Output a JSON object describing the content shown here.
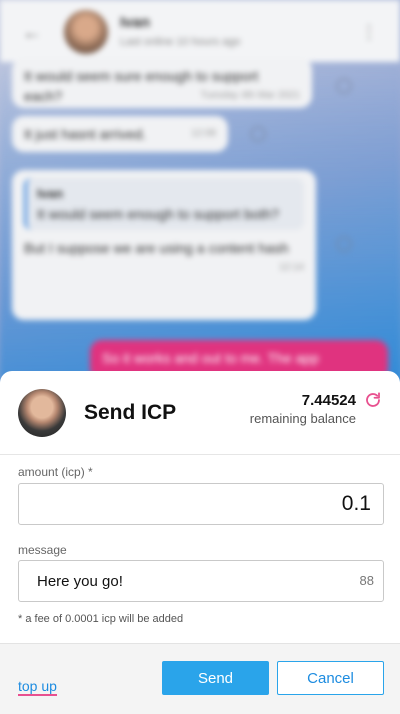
{
  "chat": {
    "header_name": "Ivan",
    "header_status": "Last online 10 hours ago",
    "messages": [
      {
        "text": "It would seem sure enough to support each?",
        "time": "Tuesday 4th Mar 2021"
      },
      {
        "text": "It just hasnt arrived.",
        "time": "12:08"
      },
      {
        "quote_name": "Ivan",
        "quote_text": "It would seem enough to support both?",
        "text": "But I suppose we are using a content hash",
        "time": "12:14"
      },
      {
        "text": "So it works and out to me. The app",
        "time": ""
      }
    ]
  },
  "dialog": {
    "title": "Send ICP",
    "balance_value": "7.44524",
    "balance_label": "remaining balance",
    "amount_label": "amount (icp) *",
    "amount_value": "0.1",
    "message_label": "message",
    "message_value": "Here you go!",
    "message_char_count": "88",
    "fee_note": "* a fee of 0.0001 icp will be added",
    "topup_label": "top up",
    "send_label": "Send",
    "cancel_label": "Cancel"
  },
  "colors": {
    "send_button": "#2aa4ea",
    "link": "#1d8ce0",
    "refresh_icon": "#e8508f",
    "link_underline": "#e8508f"
  },
  "icons": [
    "back-arrow-icon",
    "kebab-menu-icon",
    "refresh-icon"
  ]
}
